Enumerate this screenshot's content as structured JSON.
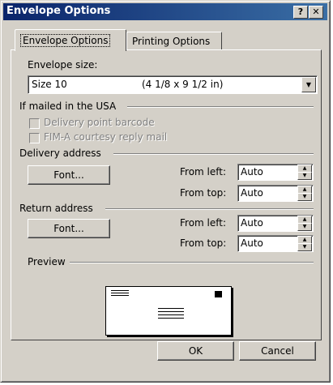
{
  "window": {
    "title": "Envelope Options",
    "help_button": "?",
    "close_button": "✕"
  },
  "tabs": [
    {
      "label": "Envelope Options",
      "active": true
    },
    {
      "label": "Printing Options",
      "active": false
    }
  ],
  "envelope_size": {
    "label": "Envelope size:",
    "selected_name": "Size 10",
    "selected_dims": "(4 1/8 x 9 1/2 in)"
  },
  "mailed_usa": {
    "group_label": "If mailed in the USA",
    "delivery_barcode": {
      "label": "Delivery point barcode",
      "checked": false,
      "enabled": false
    },
    "fim_a": {
      "label": "FIM-A courtesy reply mail",
      "checked": false,
      "enabled": false
    }
  },
  "delivery_address": {
    "group_label": "Delivery address",
    "font_button": "Font...",
    "from_left_label": "From left:",
    "from_left_value": "Auto",
    "from_top_label": "From top:",
    "from_top_value": "Auto"
  },
  "return_address": {
    "group_label": "Return address",
    "font_button": "Font...",
    "from_left_label": "From left:",
    "from_left_value": "Auto",
    "from_top_label": "From top:",
    "from_top_value": "Auto"
  },
  "preview": {
    "group_label": "Preview"
  },
  "footer": {
    "ok_label": "OK",
    "cancel_label": "Cancel"
  }
}
